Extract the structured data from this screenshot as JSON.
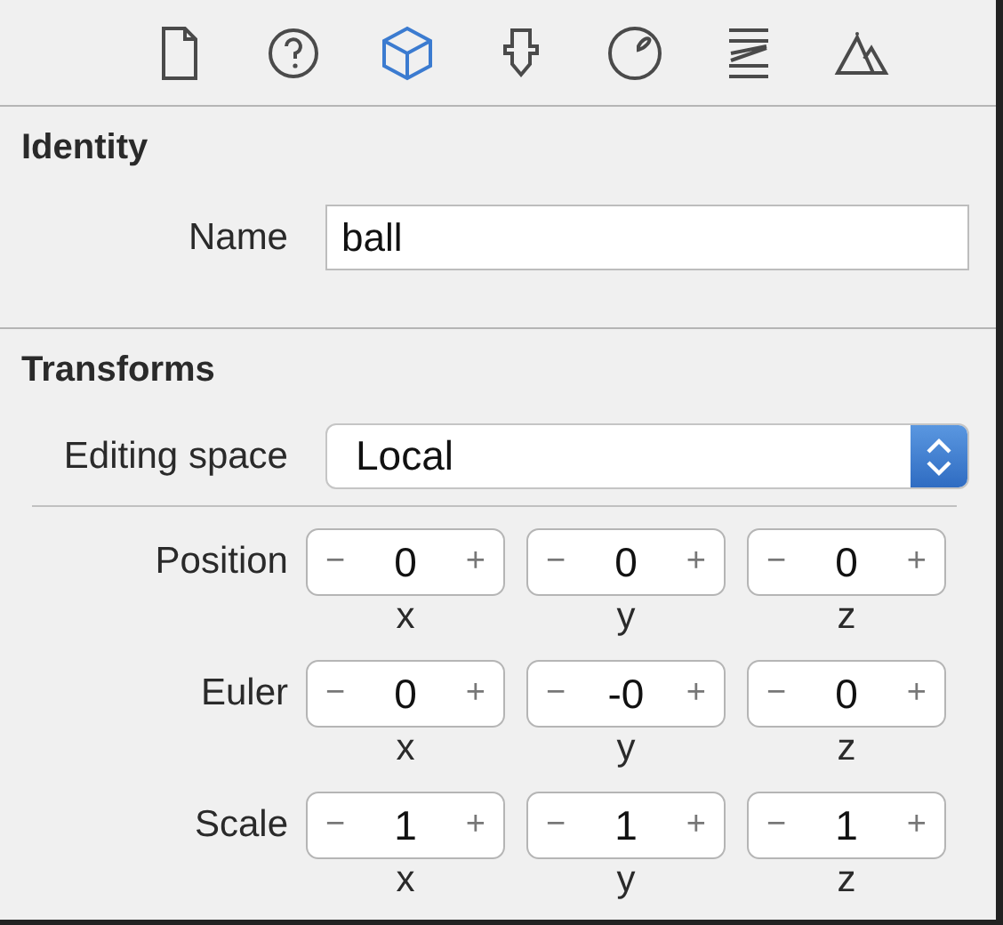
{
  "inspector_tabs": [
    {
      "kind": "file",
      "selected": false
    },
    {
      "kind": "help",
      "selected": false
    },
    {
      "kind": "cube",
      "selected": true
    },
    {
      "kind": "pin",
      "selected": false
    },
    {
      "kind": "ball",
      "selected": false
    },
    {
      "kind": "spring",
      "selected": false
    },
    {
      "kind": "mountains",
      "selected": false
    }
  ],
  "identity": {
    "heading": "Identity",
    "name_label": "Name",
    "name_value": "ball"
  },
  "transforms": {
    "heading": "Transforms",
    "editing_space_label": "Editing space",
    "editing_space_value": "Local",
    "rows": [
      {
        "label": "Position",
        "components": [
          {
            "axis": "x",
            "value": "0",
            "decrement": "−",
            "increment": "+"
          },
          {
            "axis": "y",
            "value": "0",
            "decrement": "−",
            "increment": "+"
          },
          {
            "axis": "z",
            "value": "0",
            "decrement": "−",
            "increment": "+"
          }
        ]
      },
      {
        "label": "Euler",
        "components": [
          {
            "axis": "x",
            "value": "0",
            "decrement": "−",
            "increment": "+"
          },
          {
            "axis": "y",
            "value": "-0",
            "decrement": "−",
            "increment": "+"
          },
          {
            "axis": "z",
            "value": "0",
            "decrement": "−",
            "increment": "+"
          }
        ]
      },
      {
        "label": "Scale",
        "components": [
          {
            "axis": "x",
            "value": "1",
            "decrement": "−",
            "increment": "+"
          },
          {
            "axis": "y",
            "value": "1",
            "decrement": "−",
            "increment": "+"
          },
          {
            "axis": "z",
            "value": "1",
            "decrement": "−",
            "increment": "+"
          }
        ]
      }
    ]
  }
}
